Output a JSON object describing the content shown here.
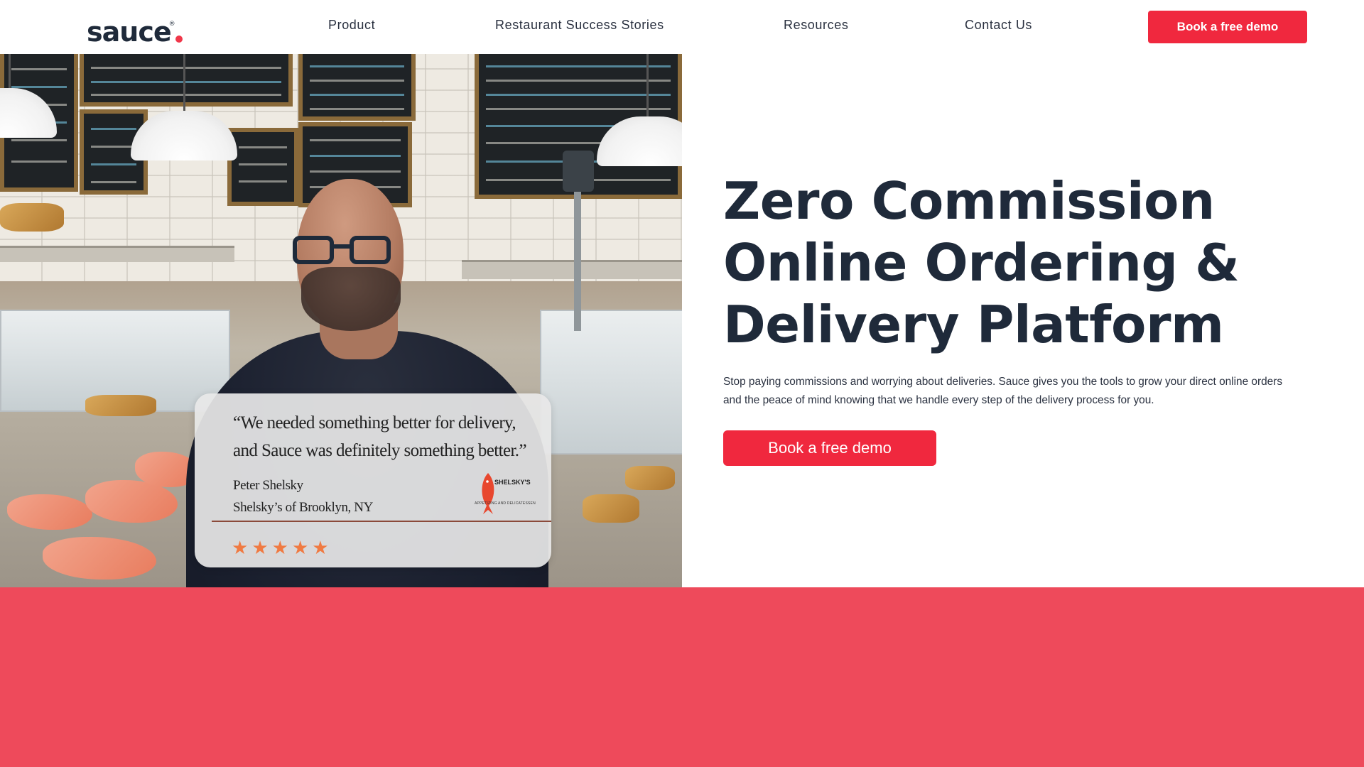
{
  "brand": {
    "logo_text": "sauce",
    "logo_mark": "®",
    "accent_color": "#f0283e",
    "band_color": "#ee4a5b"
  },
  "nav": {
    "items": [
      {
        "label": "Product"
      },
      {
        "label": "Restaurant Success Stories"
      },
      {
        "label": "Resources"
      },
      {
        "label": "Contact Us"
      }
    ],
    "cta_label": "Book a free demo"
  },
  "testimonial": {
    "quote": "“We needed something better for delivery, and Sauce was definitely something better.”",
    "name": "Peter Shelsky",
    "place": "Shelsky’s of Brooklyn, NY",
    "rating": 5,
    "star_color": "#f07a42",
    "badge": {
      "title": "SHELSKY'S",
      "subtitle": "APPETIZING AND DELICATESSEN",
      "icon": "fish-icon"
    }
  },
  "hero": {
    "title_lines": [
      "Zero Commission",
      "Online Ordering &",
      "Delivery Platform"
    ],
    "description": "Stop paying commissions and worrying about deliveries. Sauce gives you the tools to grow your direct online orders and the peace of mind knowing that we handle every step of the delivery process for you.",
    "cta_label": "Book a free demo"
  }
}
